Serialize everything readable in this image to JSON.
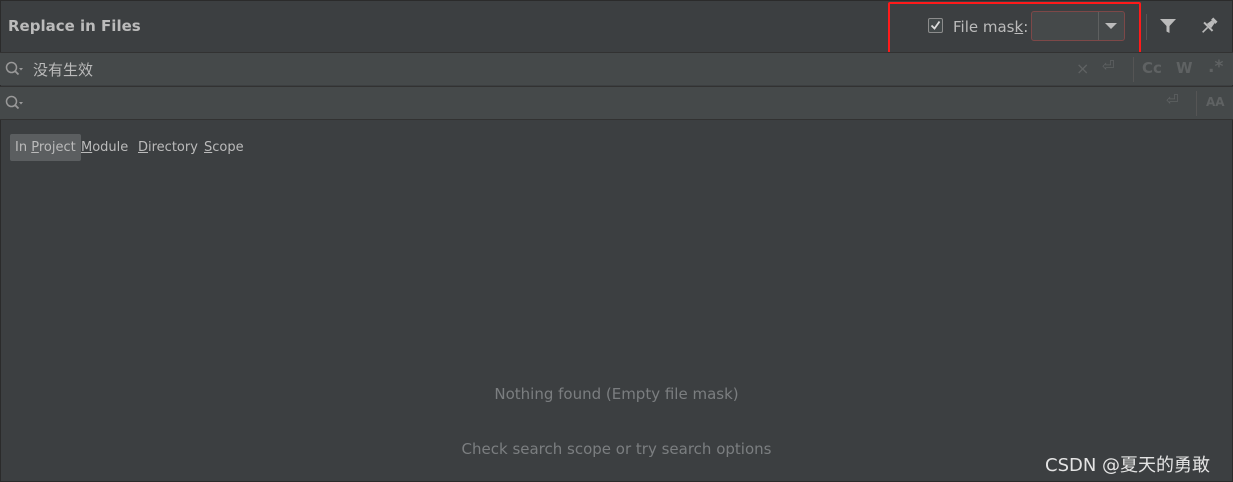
{
  "window": {
    "title": "Replace in Files"
  },
  "file_mask": {
    "checked": true,
    "label_before": "File mas",
    "label_mnemonic": "k",
    "label_after": ":",
    "value": ""
  },
  "find": {
    "text": "没有生效",
    "icon": "search-history-icon"
  },
  "replace": {
    "text": "",
    "icon": "search-history-icon"
  },
  "options": {
    "clear": "×",
    "newline": "⏎",
    "match_case": "Cc",
    "words": "W",
    "regex": ".*",
    "preserve_case": "AA"
  },
  "scope_tabs": [
    {
      "pre": "In ",
      "mnemonic": "P",
      "post": "roject",
      "selected": true
    },
    {
      "pre": "",
      "mnemonic": "M",
      "post": "odule",
      "selected": false
    },
    {
      "pre": "",
      "mnemonic": "D",
      "post": "irectory",
      "selected": false
    },
    {
      "pre": "",
      "mnemonic": "S",
      "post": "cope",
      "selected": false
    }
  ],
  "results": {
    "empty_title": "Nothing found (Empty file mask)",
    "empty_hint": "Check search scope or try search options"
  },
  "watermark": "CSDN @夏天的勇敢",
  "colors": {
    "background": "#3c3f41",
    "field": "#45494a",
    "highlight": "#ff1a1a",
    "error_border": "#7d4848"
  }
}
